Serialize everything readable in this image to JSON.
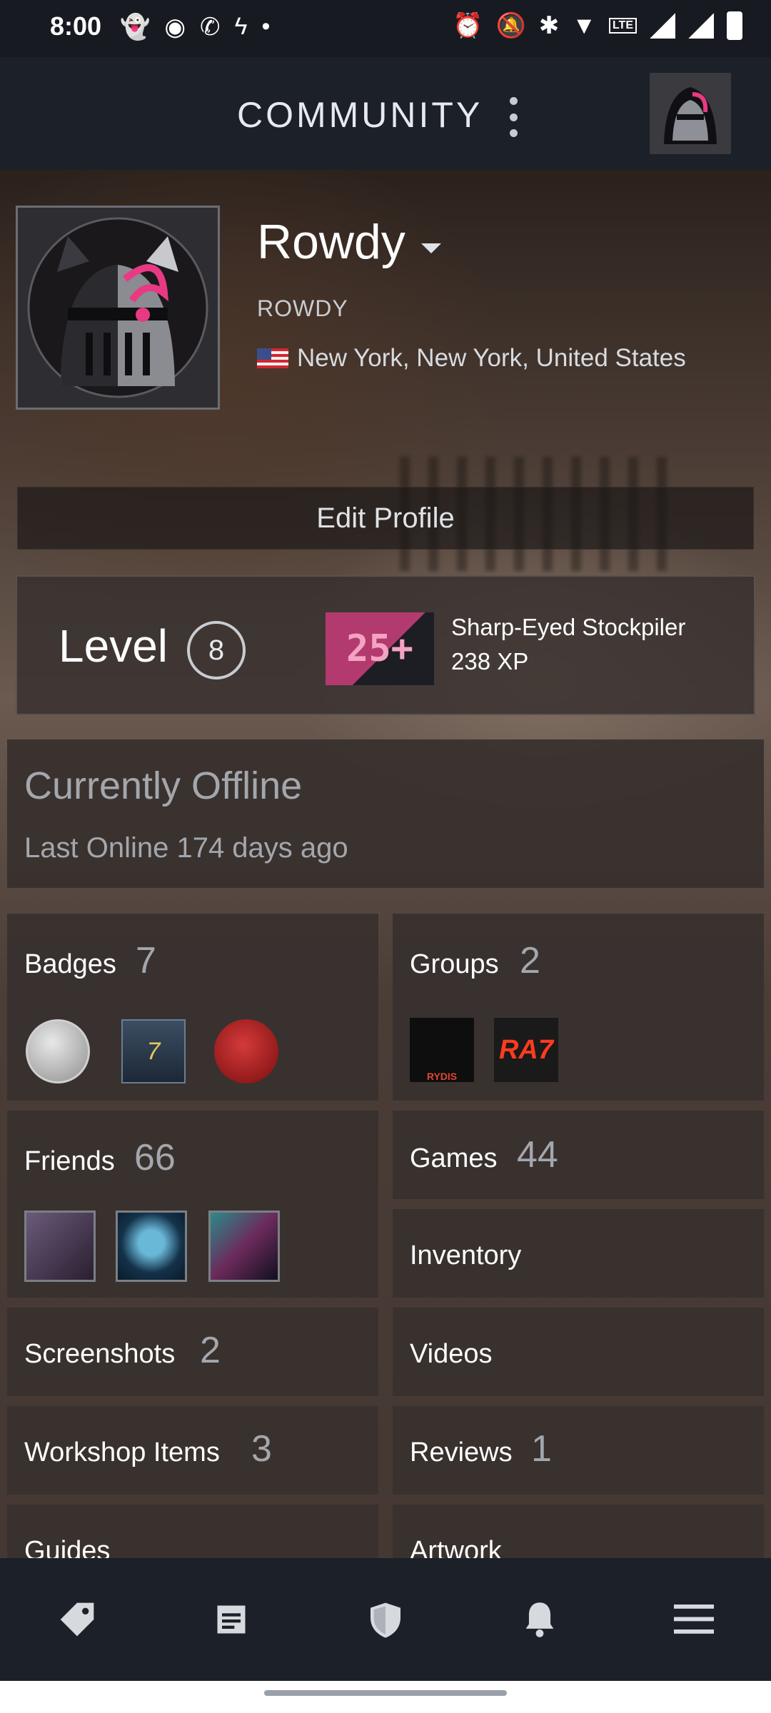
{
  "status_bar": {
    "time": "8:00"
  },
  "header": {
    "title": "COMMUNITY"
  },
  "profile": {
    "name": "Rowdy",
    "real_name": "ROWDY",
    "location": "New York, New York, United States"
  },
  "edit_profile_label": "Edit Profile",
  "level": {
    "label": "Level",
    "value": "8",
    "badge_text": "25+",
    "badge_name": "Sharp-Eyed Stockpiler",
    "badge_xp": "238 XP"
  },
  "status": {
    "state": "Currently Offline",
    "last_online": "Last Online 174 days ago"
  },
  "tiles": {
    "badges": {
      "label": "Badges",
      "count": "7",
      "icon_text": "7"
    },
    "groups": {
      "label": "Groups",
      "count": "2",
      "group1_text": "RYDIS",
      "group2_text": "RA7"
    },
    "friends": {
      "label": "Friends",
      "count": "66"
    },
    "games": {
      "label": "Games",
      "count": "44"
    },
    "inventory": {
      "label": "Inventory"
    },
    "screenshots": {
      "label": "Screenshots",
      "count": "2"
    },
    "videos": {
      "label": "Videos"
    },
    "workshop": {
      "label": "Workshop Items",
      "count": "3"
    },
    "reviews": {
      "label": "Reviews",
      "count": "1"
    },
    "guides": {
      "label": "Guides"
    },
    "artwork": {
      "label": "Artwork"
    }
  },
  "bottom_nav": [
    "tag-icon",
    "news-icon",
    "shield-icon",
    "bell-icon",
    "menu-icon"
  ],
  "colors": {
    "nav_bg": "#1b2029",
    "tile_bg": "#38302e",
    "muted_text": "#a3a7ad"
  }
}
